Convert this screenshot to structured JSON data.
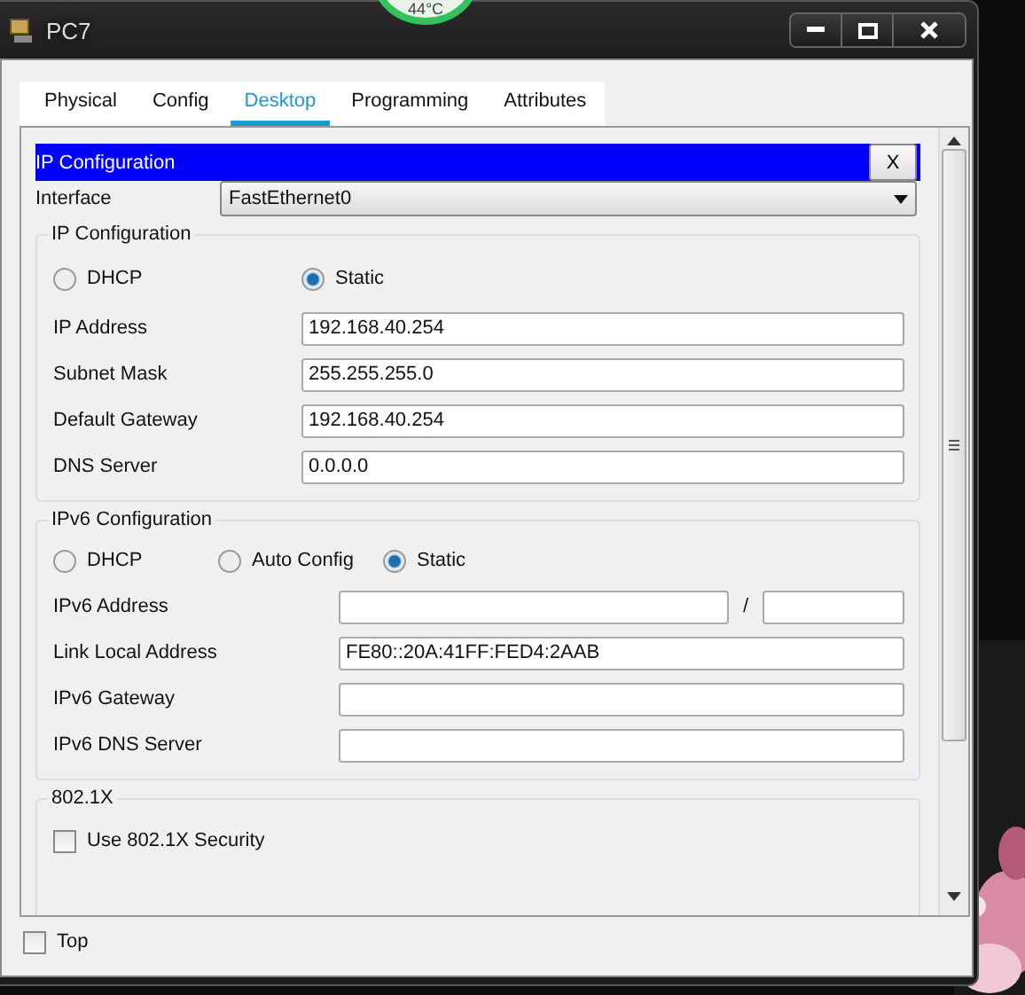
{
  "desktop": {
    "gadget": "44°C"
  },
  "window": {
    "title": "PC7"
  },
  "tabs": [
    {
      "label": "Physical",
      "selected": false
    },
    {
      "label": "Config",
      "selected": false
    },
    {
      "label": "Desktop",
      "selected": true
    },
    {
      "label": "Programming",
      "selected": false
    },
    {
      "label": "Attributes",
      "selected": false
    }
  ],
  "panel": {
    "title": "IP Configuration",
    "close": "X"
  },
  "interface": {
    "label": "Interface",
    "value": "FastEthernet0"
  },
  "ipv4": {
    "title": "IP Configuration",
    "modes": [
      {
        "label": "DHCP",
        "selected": false
      },
      {
        "label": "Static",
        "selected": true
      }
    ],
    "fields": [
      {
        "label": "IP Address",
        "value": "192.168.40.254"
      },
      {
        "label": "Subnet Mask",
        "value": "255.255.255.0"
      },
      {
        "label": "Default Gateway",
        "value": "192.168.40.254"
      },
      {
        "label": "DNS Server",
        "value": "0.0.0.0"
      }
    ]
  },
  "ipv6": {
    "title": "IPv6 Configuration",
    "modes": [
      {
        "label": "DHCP",
        "selected": false
      },
      {
        "label": "Auto Config",
        "selected": false
      },
      {
        "label": "Static",
        "selected": true
      }
    ],
    "fields": [
      {
        "label": "IPv6 Address",
        "kind": "prefixed",
        "separator": "/"
      },
      {
        "label": "Link Local Address",
        "kind": "plain",
        "value": "FE80::20A:41FF:FED4:2AAB"
      },
      {
        "label": "IPv6 Gateway",
        "kind": "plain"
      },
      {
        "label": "IPv6 DNS Server",
        "kind": "plain"
      }
    ]
  },
  "dot1x": {
    "title": "802.1X",
    "checkbox": {
      "label": "Use 802.1X Security",
      "checked": false
    }
  },
  "top": {
    "label": "Top",
    "checked": false
  }
}
